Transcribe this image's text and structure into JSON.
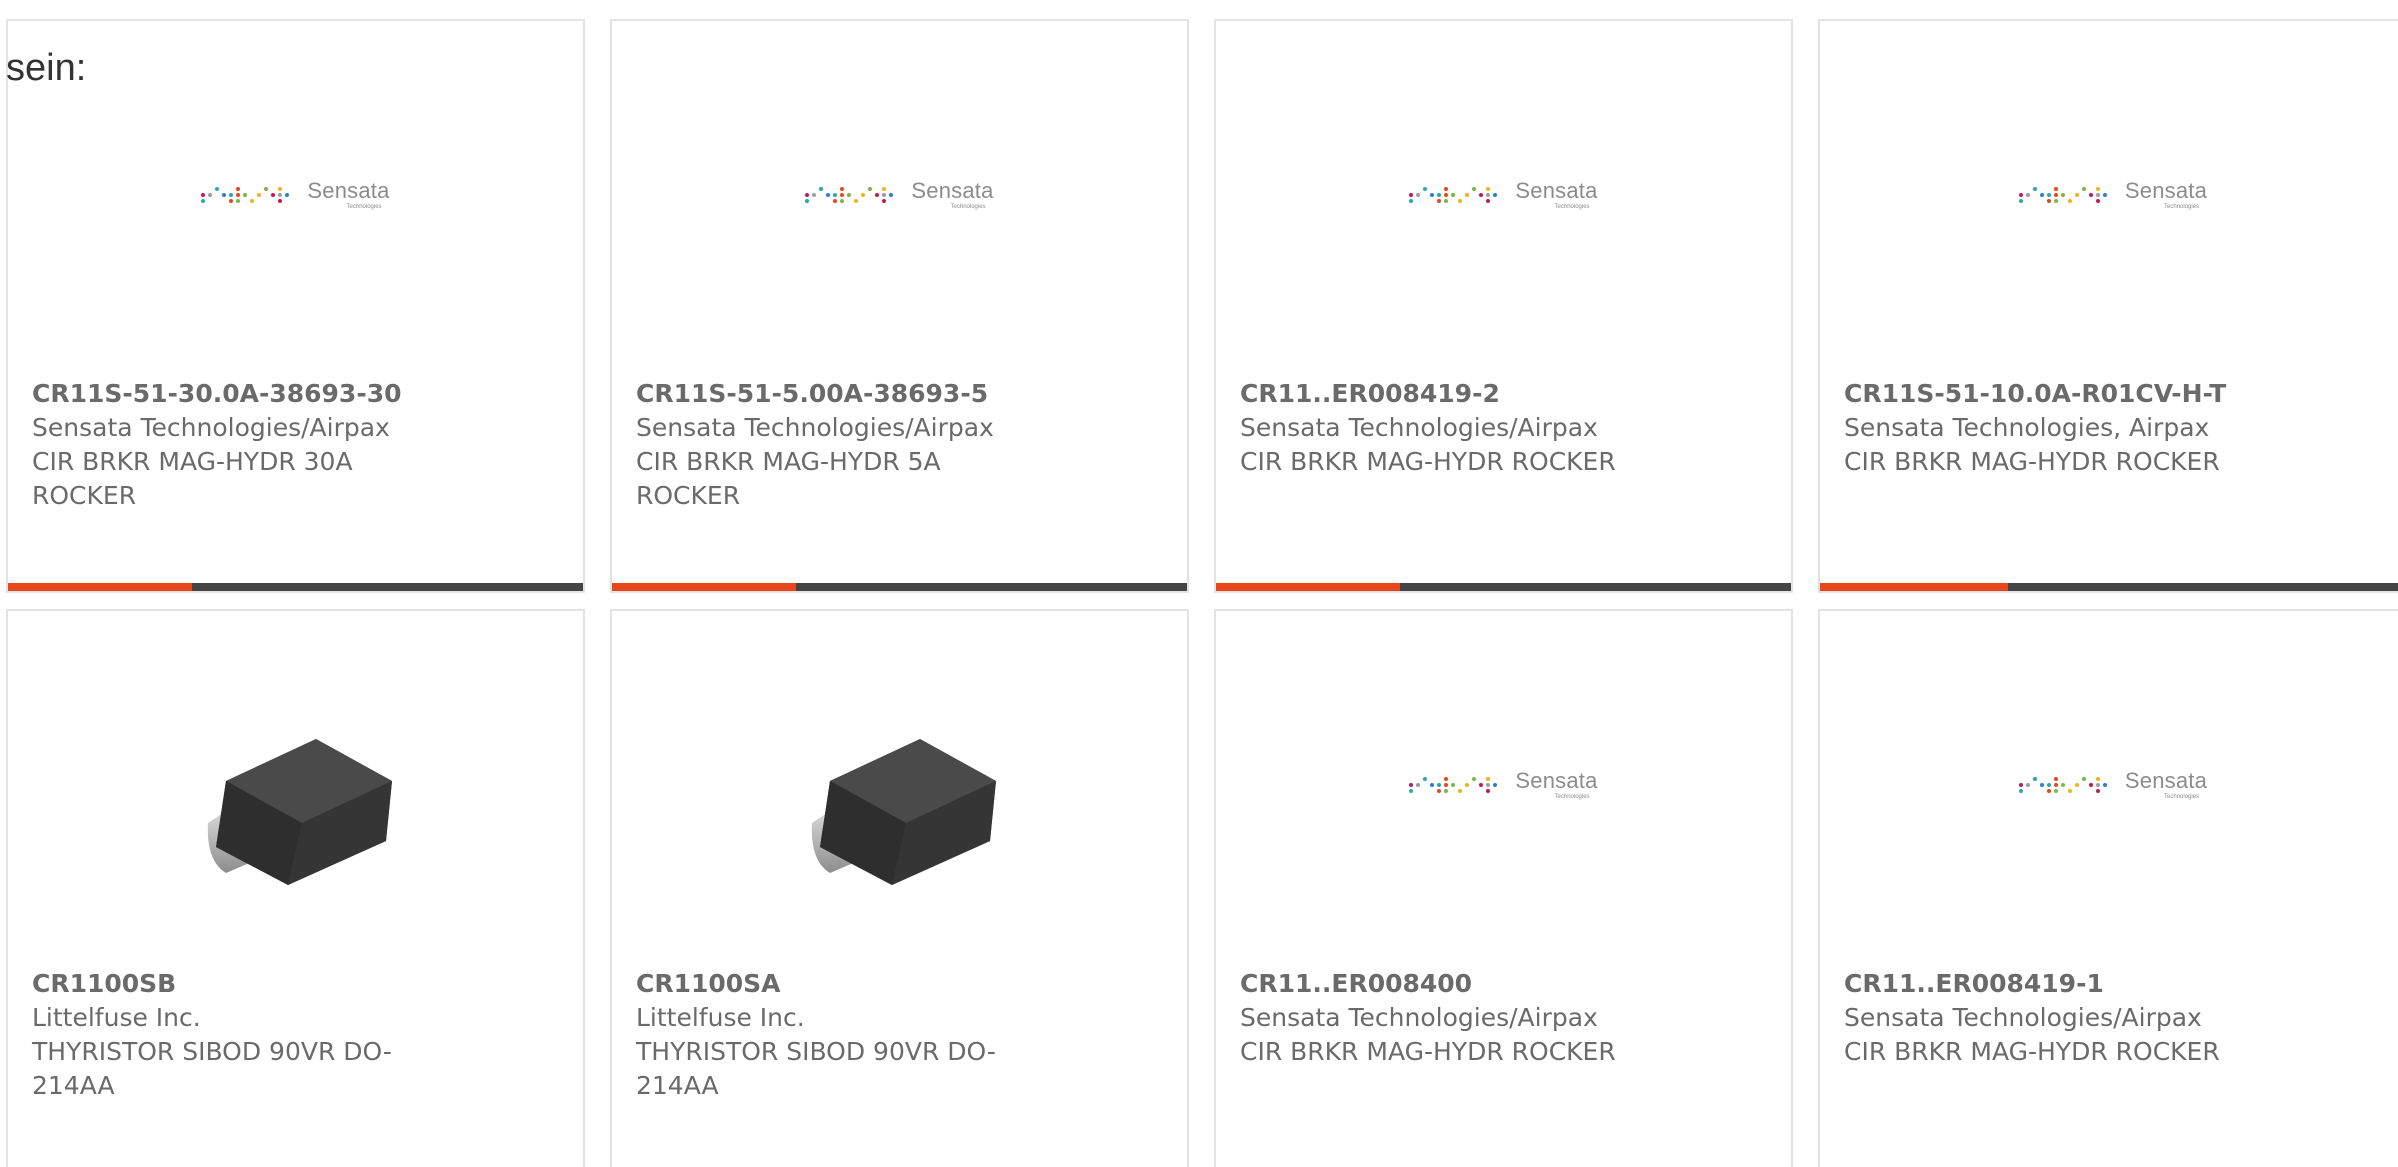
{
  "heading": "sein:",
  "colors": {
    "accent": "#e8471b",
    "bar_track": "#444444",
    "card_border": "#e3e3e3",
    "text": "#6a6a6a"
  },
  "logo": {
    "name": "Sensata",
    "tagline": "Technologies"
  },
  "cards": [
    {
      "part_number": "CR11S-51-30.0A-38693-30",
      "manufacturer": "Sensata Technologies/Airpax",
      "description": "CIR BRKR MAG-HYDR 30A ROCKER",
      "image": "sensata-logo",
      "progress": 0.32
    },
    {
      "part_number": "CR11S-51-5.00A-38693-5",
      "manufacturer": "Sensata Technologies/Airpax",
      "description": "CIR BRKR MAG-HYDR 5A ROCKER",
      "image": "sensata-logo",
      "progress": 0.32
    },
    {
      "part_number": "CR11..ER008419-2",
      "manufacturer": "Sensata Technologies/Airpax",
      "description": "CIR BRKR MAG-HYDR ROCKER",
      "image": "sensata-logo",
      "progress": 0.32
    },
    {
      "part_number": "CR11S-51-10.0A-R01CV-H-T",
      "manufacturer": "Sensata Technologies, Airpax",
      "description": "CIR BRKR MAG-HYDR ROCKER",
      "image": "sensata-logo",
      "progress": 0.32
    },
    {
      "part_number": "CR1100SB",
      "manufacturer": "Littelfuse Inc.",
      "description": "THYRISTOR SIBOD 90VR DO-214AA",
      "image": "do214aa-package"
    },
    {
      "part_number": "CR1100SA",
      "manufacturer": "Littelfuse Inc.",
      "description": "THYRISTOR SIBOD 90VR DO-214AA",
      "image": "do214aa-package"
    },
    {
      "part_number": "CR11..ER008400",
      "manufacturer": "Sensata Technologies/Airpax",
      "description": "CIR BRKR MAG-HYDR ROCKER",
      "image": "sensata-logo"
    },
    {
      "part_number": "CR11..ER008419-1",
      "manufacturer": "Sensata Technologies/Airpax",
      "description": "CIR BRKR MAG-HYDR ROCKER",
      "image": "sensata-logo"
    }
  ]
}
